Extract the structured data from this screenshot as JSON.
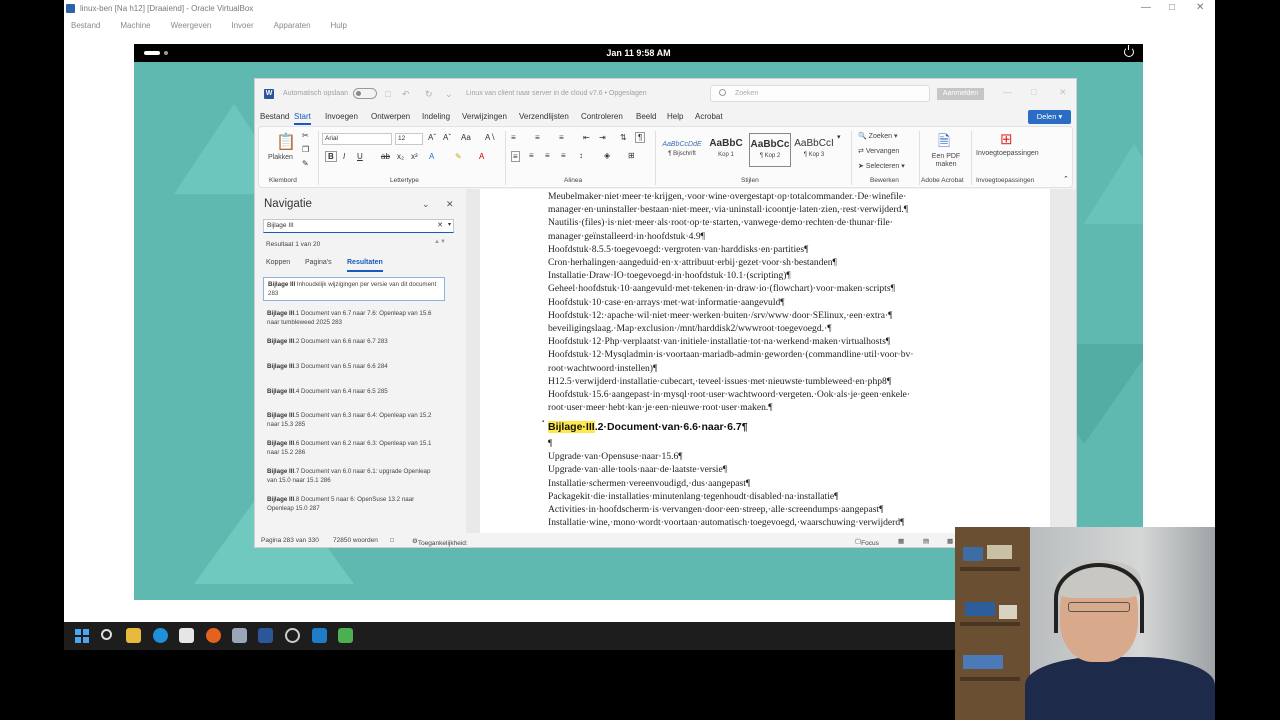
{
  "host": {
    "title": "linux-ben [Na h12] [Draaiend] - Oracle VirtualBox",
    "menu": [
      "Bestand",
      "Machine",
      "Weergeven",
      "Invoer",
      "Apparaten",
      "Hulp"
    ]
  },
  "gnome": {
    "clock": "Jan 11  9:58 AM"
  },
  "word": {
    "autosave": "Automatisch opslaan",
    "doc_title": "Linux van client naar server in de cloud v7.6 • Opgeslagen",
    "search_placeholder": "Zoeken",
    "signin": "Aanmelden",
    "share": "Delen",
    "tabs": [
      "Bestand",
      "Start",
      "Invoegen",
      "Ontwerpen",
      "Indeling",
      "Verwijzingen",
      "Verzendlijsten",
      "Controleren",
      "Beeld",
      "Help",
      "Acrobat"
    ],
    "ribbon": {
      "groups": [
        "Klembord",
        "Lettertype",
        "Alinea",
        "Stijlen",
        "Bewerken",
        "Adobe Acrobat",
        "Invoegtoepassingen"
      ],
      "paste": "Plakken",
      "font_name": "Arial",
      "font_size": "12",
      "styles": [
        {
          "preview": "AaBbCcDdE",
          "name": "¶ Bijschrift"
        },
        {
          "preview": "AaBbC",
          "name": "Kop 1"
        },
        {
          "preview": "AaBbCc",
          "name": "¶ Kop 2"
        },
        {
          "preview": "AaBbCcI",
          "name": "¶ Kop 3"
        }
      ],
      "find": "Zoeken",
      "replace": "Vervangen",
      "select": "Selecteren",
      "pdf": "Een PDF maken",
      "addins": "Invoegtoepassingen"
    },
    "nav": {
      "title": "Navigatie",
      "search_value": "Bijlage III",
      "result_count": "Resultaat 1 van 20",
      "tabs": [
        "Koppen",
        "Pagina's",
        "Resultaten"
      ],
      "results": [
        {
          "bold": "Bijlage III",
          "rest": " Inhoudelijk wijzigingen per versie van dit document 283"
        },
        {
          "bold": "Bijlage III",
          "rest": ".1 Document van 6.7 naar 7.6: Openleap van 15.6 naar tumbleweed 2025 283"
        },
        {
          "bold": "Bijlage III",
          "rest": ".2 Document van 6.6 naar 6.7 283"
        },
        {
          "bold": "Bijlage III",
          "rest": ".3 Document van 6.5 naar 6.6 284"
        },
        {
          "bold": "Bijlage III",
          "rest": ".4 Document van 6.4 naar 6.5 285"
        },
        {
          "bold": "Bijlage III",
          "rest": ".5 Document van 6.3 naar 6.4: Openleap van 15.2 naar 15.3 285"
        },
        {
          "bold": "Bijlage III",
          "rest": ".6 Document van 6.2 naar 6.3: Openleap van 15.1 naar 15.2 286"
        },
        {
          "bold": "Bijlage III",
          "rest": ".7 Document van 6.0 naar 6.1: upgrade Openleap van 15.0 naar 15.1 286"
        },
        {
          "bold": "Bijlage III",
          "rest": ".8 Document 5 naar 6: OpenSuse 13.2 naar Openleap 15.0 287"
        }
      ]
    },
    "doc_lines": [
      "Meubelmaker·niet·meer·te·krijgen,·voor·wine·overgestapt·op·totalcommander.·De·winefile·",
      "manager·en·uninstaller·bestaan·niet·meer,·via·uninstall·icoontje·laten·zien,·rest·verwijderd.¶",
      "Nautilis·(files)·is·niet·meer·als·root·op·te·starten,·vanwege·demo·rechten·de·thunar·file·",
      "manager·geïnstalleerd·in·hoofdstuk·4.9¶",
      "Hoofdstuk·8.5.5·toegevoegd:·vergroten·van·harddisks·en·partities¶",
      "Cron·herhalingen·aangeduid·en·x·attribuut·erbij·gezet·voor·sh·bestanden¶",
      "Installatie·Draw·IO·toegevoegd·in·hoofdstuk·10.1·(scripting)¶",
      "Geheel·hoofdstuk·10·aangevuld·met·tekenen·in·draw·io·(flowchart)·voor·maken·scripts¶",
      "Hoofdstuk·10·case·en·arrays·met·wat·informatie·aangevuld¶",
      "Hoofdstuk·12:·apache·wil·niet·meer·werken·buiten·/srv/www·door·SElinux,·een·extra·¶",
      "beveiligingslaag.·Map·exclusion·/mnt/harddisk2/wwwroot·toegevoegd.·¶",
      "Hoofdstuk·12·Php·verplaatst·van·initiele·installatie·tot·na·werkend·maken·virtualhosts¶",
      "Hoofdstuk·12·Mysqladmin·is·voortaan·mariadb-admin·geworden·(commandline·util·voor·bv·",
      "root·wachtwoord·instellen)¶",
      "H12.5·verwijderd·installatie·cubecart,·teveel·issues·met·nieuwste·tumbleweed·en·php8¶",
      "Hoofdstuk·15.6·aangepast·in·mysql·root·user·wachtwoord·vergeten.·Ook·als·je·geen·enkele·",
      "root·user·meer·hebt·kan·je·een·nieuwe·root·user·maken.¶"
    ],
    "heading_hl": "Bijlage·III",
    "heading_rest": ".2·Document·van·6.6·naar·6.7¶",
    "doc_lines2": [
      "¶",
      "Upgrade·van·Opensuse·naar·15.6¶",
      "Upgrade·van·alle·tools·naar·de·laatste·versie¶",
      "Installatie·schermen·vereenvoudigd,·dus·aangepast¶",
      "Packagekit·die·installaties·minutenlang·tegenhoudt·disabled·na·installatie¶",
      "Activities·in·hoofdscherm·is·vervangen·door·een·streep,·alle·screendumps·aangepast¶",
      "Installatie·wine,·mono·wordt·voortaan·automatisch·toegevoegd,·waarschuwing·verwijderd¶"
    ],
    "status": {
      "page": "Pagina 283 van 330",
      "words": "72850 woorden",
      "accessibility": "Toegankelijkheid: onderzoeken",
      "focus": "Focus"
    }
  }
}
